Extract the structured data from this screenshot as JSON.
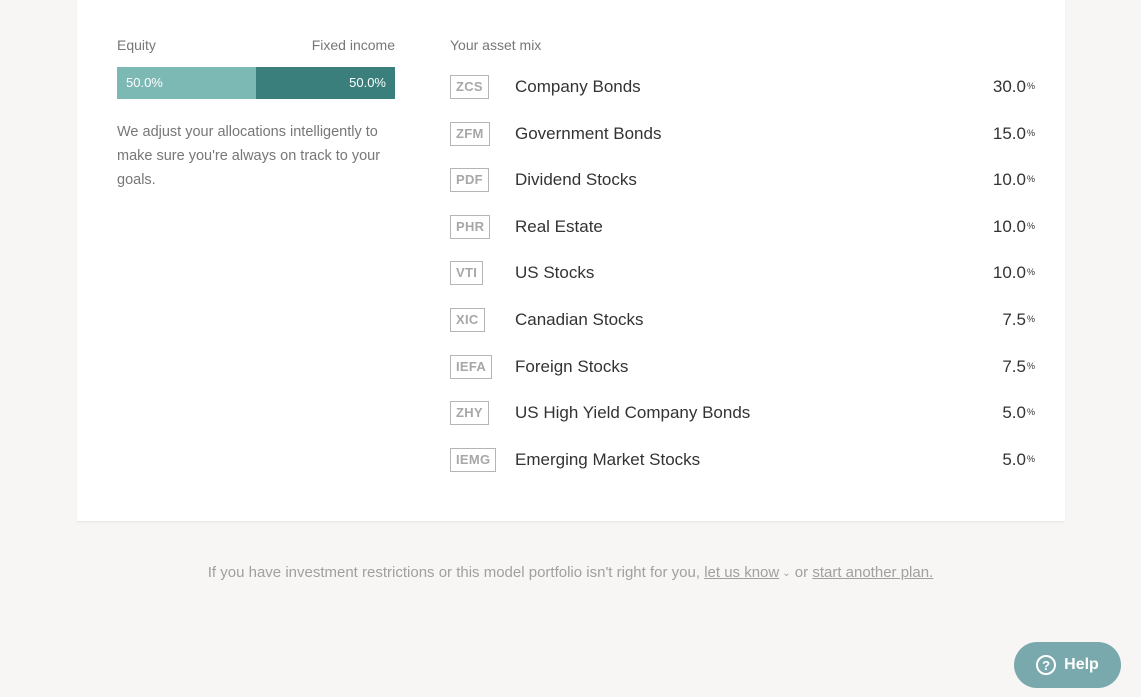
{
  "allocation": {
    "equity_label": "Equity",
    "fixed_label": "Fixed income",
    "equity_pct": "50.0%",
    "fixed_pct": "50.0%",
    "equity_fraction": 0.5,
    "description": "We adjust your allocations intelligently to make sure you're always on track to your goals."
  },
  "mix": {
    "title": "Your asset mix",
    "percent_symbol": "%",
    "rows": [
      {
        "ticker": "ZCS",
        "name": "Company Bonds",
        "pct": "30.0"
      },
      {
        "ticker": "ZFM",
        "name": "Government Bonds",
        "pct": "15.0"
      },
      {
        "ticker": "PDF",
        "name": "Dividend Stocks",
        "pct": "10.0"
      },
      {
        "ticker": "PHR",
        "name": "Real Estate",
        "pct": "10.0"
      },
      {
        "ticker": "VTI",
        "name": "US Stocks",
        "pct": "10.0"
      },
      {
        "ticker": "XIC",
        "name": "Canadian Stocks",
        "pct": "7.5"
      },
      {
        "ticker": "IEFA",
        "name": "Foreign Stocks",
        "pct": "7.5"
      },
      {
        "ticker": "ZHY",
        "name": "US High Yield Company Bonds",
        "pct": "5.0"
      },
      {
        "ticker": "IEMG",
        "name": "Emerging Market Stocks",
        "pct": "5.0"
      }
    ]
  },
  "footer": {
    "text_before": "If you have investment restrictions or this model portfolio isn't right for you, ",
    "link1": "let us know",
    "chevron_icon": "chevron-down-icon",
    "text_middle": " or ",
    "link2": "start another plan."
  },
  "help": {
    "label": "Help",
    "icon": "question-circle-icon"
  }
}
